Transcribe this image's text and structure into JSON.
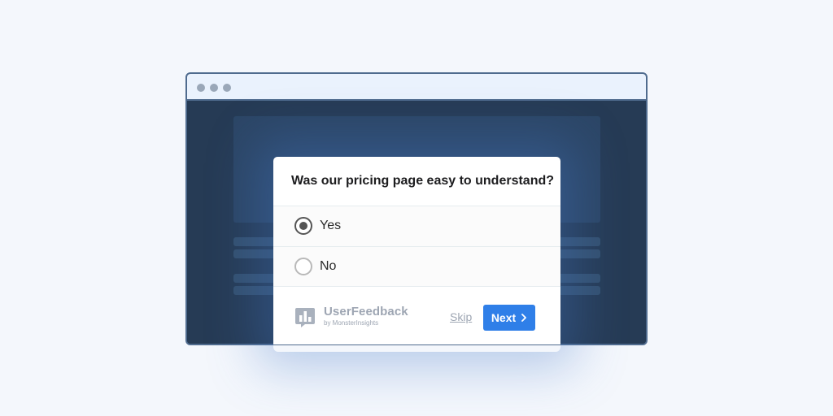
{
  "survey": {
    "question": "Was our pricing page easy to understand?",
    "options": [
      {
        "label": "Yes",
        "selected": true
      },
      {
        "label": "No",
        "selected": false
      }
    ]
  },
  "footer": {
    "brand_name": "UserFeedback",
    "brand_sub": "by MonsterInsights",
    "brand_icon": "bar-chart-speech-icon",
    "skip_label": "Skip",
    "next_label": "Next",
    "next_icon": "chevron-right-icon"
  },
  "colors": {
    "page_background": "#f4f7fc",
    "browser_viewport": "#263b55",
    "browser_titlebar": "#eaf2fd",
    "accent": "#2f7fe8"
  }
}
